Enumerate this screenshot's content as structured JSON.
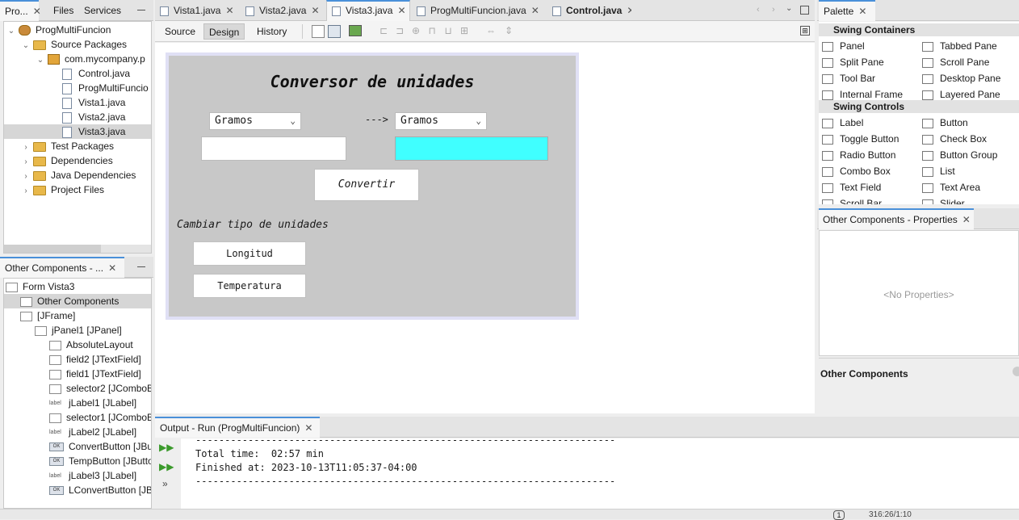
{
  "projects_panel": {
    "tabs": [
      "Pro...",
      "Files",
      "Services"
    ],
    "tree": [
      {
        "label": "ProgMultiFuncion",
        "kind": "project",
        "indent": 0,
        "expanded": true
      },
      {
        "label": "Source Packages",
        "kind": "folder",
        "indent": 1,
        "expanded": true
      },
      {
        "label": "com.mycompany.p",
        "kind": "package",
        "indent": 2,
        "expanded": true
      },
      {
        "label": "Control.java",
        "kind": "file",
        "indent": 3
      },
      {
        "label": "ProgMultiFuncio",
        "kind": "file",
        "indent": 3
      },
      {
        "label": "Vista1.java",
        "kind": "file",
        "indent": 3
      },
      {
        "label": "Vista2.java",
        "kind": "file",
        "indent": 3
      },
      {
        "label": "Vista3.java",
        "kind": "file",
        "indent": 3,
        "selected": true
      },
      {
        "label": "Test Packages",
        "kind": "folder",
        "indent": 1
      },
      {
        "label": "Dependencies",
        "kind": "folder",
        "indent": 1
      },
      {
        "label": "Java Dependencies",
        "kind": "folder",
        "indent": 1
      },
      {
        "label": "Project Files",
        "kind": "folder",
        "indent": 1
      }
    ]
  },
  "navigator_panel": {
    "title": "Other Components - ...",
    "tree": [
      {
        "label": "Form Vista3",
        "icon": "form-icon"
      },
      {
        "label": "Other Components",
        "icon": "components-icon",
        "selected": true
      },
      {
        "label": "[JFrame]",
        "icon": "frame-icon"
      },
      {
        "label": "jPanel1 [JPanel]",
        "icon": "panel-icon"
      },
      {
        "label": "AbsoluteLayout",
        "icon": "layout-icon"
      },
      {
        "label": "field2 [JTextField]",
        "icon": "textfield-icon"
      },
      {
        "label": "field1 [JTextField]",
        "icon": "textfield-icon"
      },
      {
        "label": "selector2 [JComboB",
        "icon": "combobox-icon"
      },
      {
        "label": "jLabel1 [JLabel]",
        "icon": "label-icon"
      },
      {
        "label": "selector1 [JComboB",
        "icon": "combobox-icon"
      },
      {
        "label": "jLabel2 [JLabel]",
        "icon": "label-icon"
      },
      {
        "label": "ConvertButton [JBu",
        "icon": "button-icon"
      },
      {
        "label": "TempButton [JButto",
        "icon": "button-icon"
      },
      {
        "label": "jLabel3 [JLabel]",
        "icon": "label-icon"
      },
      {
        "label": "LConvertButton [JB",
        "icon": "button-icon"
      }
    ]
  },
  "editor": {
    "tabs": [
      {
        "label": "Vista1.java"
      },
      {
        "label": "Vista2.java"
      },
      {
        "label": "Vista3.java",
        "active": true
      },
      {
        "label": "ProgMultiFuncion.java"
      },
      {
        "label": "Control.java",
        "bold": true
      }
    ],
    "views": [
      "Source",
      "Design",
      "History"
    ],
    "active_view": "Design"
  },
  "form": {
    "title": "Conversor de unidades",
    "selector1": "Gramos",
    "arrow": "--->",
    "selector2": "Gramos",
    "field1_value": "",
    "field2_value": "",
    "convert_label": "Convertir",
    "change_label": "Cambiar tipo de unidades",
    "length_label": "Longitud",
    "temp_label": "Temperatura",
    "field2_color": "#40ffff"
  },
  "palette": {
    "title": "Palette",
    "sections": [
      {
        "name": "Swing Containers",
        "items": [
          [
            "Panel",
            "Tabbed Pane"
          ],
          [
            "Split Pane",
            "Scroll Pane"
          ],
          [
            "Tool Bar",
            "Desktop Pane"
          ],
          [
            "Internal Frame",
            "Layered Pane"
          ]
        ]
      },
      {
        "name": "Swing Controls",
        "items": [
          [
            "Label",
            "Button"
          ],
          [
            "Toggle Button",
            "Check Box"
          ],
          [
            "Radio Button",
            "Button Group"
          ],
          [
            "Combo Box",
            "List"
          ],
          [
            "Text Field",
            "Text Area"
          ],
          [
            "Scroll Bar",
            "Slider"
          ]
        ]
      }
    ]
  },
  "properties": {
    "title": "Other Components - Properties",
    "empty_text": "<No Properties>",
    "footer_title": "Other Components"
  },
  "output": {
    "title": "Output - Run (ProgMultiFuncion)",
    "lines": [
      "------------------------------------------------------------------------",
      "Total time:  02:57 min",
      "Finished at: 2023-10-13T11:05:37-04:00",
      "------------------------------------------------------------------------"
    ]
  },
  "status_bar": {
    "notifications": "1",
    "position": "316:26/1:10"
  }
}
